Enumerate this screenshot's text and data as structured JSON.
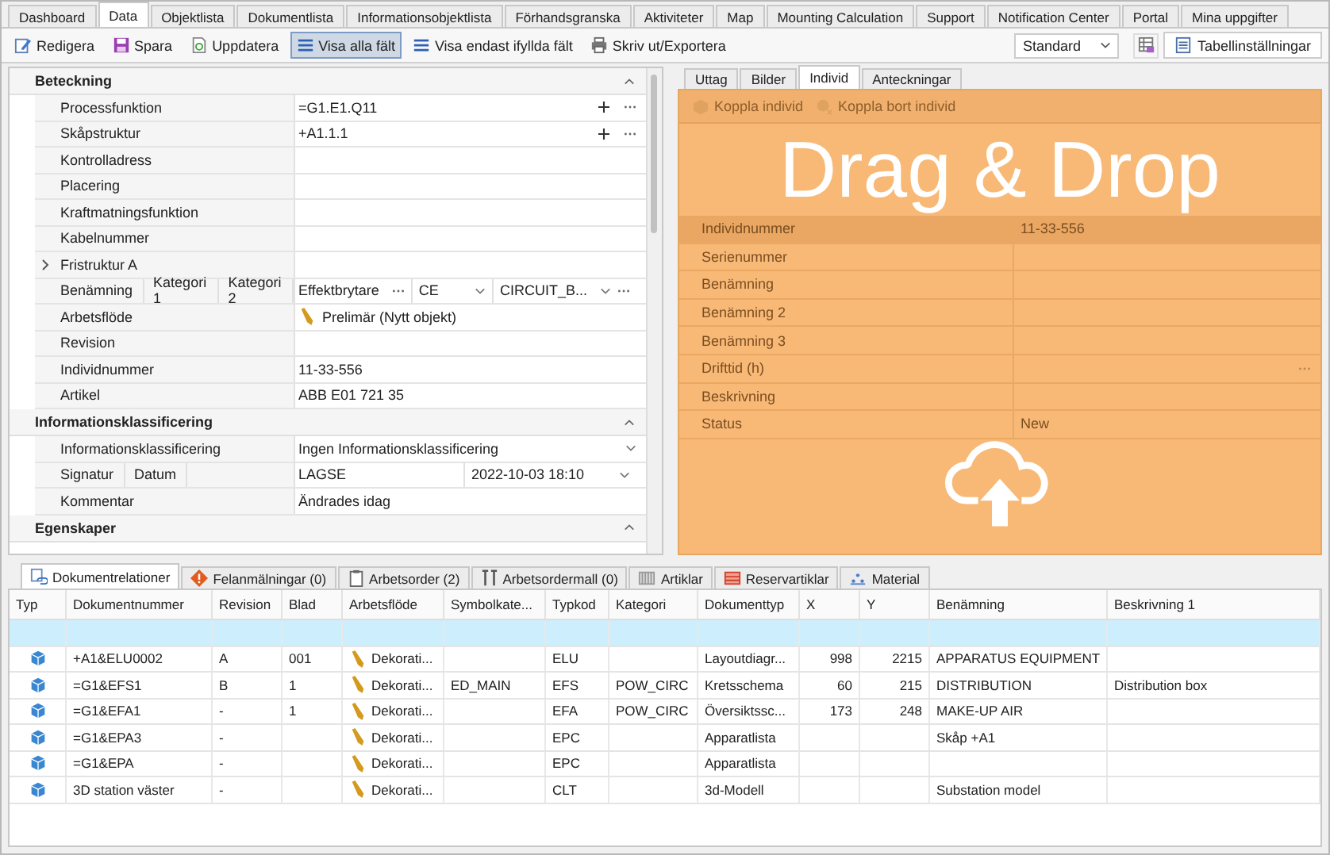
{
  "top_tabs": [
    {
      "label": "Dashboard",
      "selected": false
    },
    {
      "label": "Data",
      "selected": true
    },
    {
      "label": "Objektlista",
      "selected": false
    },
    {
      "label": "Dokumentlista",
      "selected": false
    },
    {
      "label": "Informationsobjektlista",
      "selected": false
    },
    {
      "label": "Förhandsgranska",
      "selected": false
    },
    {
      "label": "Aktiviteter",
      "selected": false
    },
    {
      "label": "Map",
      "selected": false
    },
    {
      "label": "Mounting Calculation",
      "selected": false
    },
    {
      "label": "Support",
      "selected": false
    },
    {
      "label": "Notification Center",
      "selected": false
    },
    {
      "label": "Portal",
      "selected": false
    },
    {
      "label": "Mina uppgifter",
      "selected": false
    }
  ],
  "toolbar": {
    "buttons": [
      {
        "label": "Redigera",
        "kind": "edit",
        "selected": false
      },
      {
        "label": "Spara",
        "kind": "save",
        "selected": false
      },
      {
        "label": "Uppdatera",
        "kind": "refresh",
        "selected": false
      },
      {
        "label": "Visa alla fält",
        "kind": "list",
        "selected": true
      },
      {
        "label": "Visa endast ifyllda fält",
        "kind": "list",
        "selected": false
      },
      {
        "label": "Skriv ut/Exportera",
        "kind": "print",
        "selected": false
      }
    ],
    "view_select": {
      "value": "Standard"
    },
    "table_settings_button": "Tabellinställningar"
  },
  "form": {
    "sections": [
      {
        "title": "Beteckning",
        "expanded": true,
        "rows": [
          {
            "kind": "field",
            "label": "Processfunktion",
            "value": "=G1.E1.Q11",
            "buttons": true
          },
          {
            "kind": "field",
            "label": "Skåpstruktur",
            "value": "+A1.1.1",
            "buttons": true
          },
          {
            "kind": "field",
            "label": "Kontrolladress"
          },
          {
            "kind": "field",
            "label": "Placering"
          },
          {
            "kind": "field",
            "label": "Kraftmatningsfunktion"
          },
          {
            "kind": "field",
            "label": "Kabelnummer"
          },
          {
            "kind": "group",
            "label": "Fristruktur A",
            "expanded": false
          },
          {
            "kind": "multi",
            "labels": [
              "Benämning",
              "Kategori 1",
              "Kategori 2"
            ],
            "values": [
              {
                "text": "Effektbrytare",
                "kind": "more"
              },
              {
                "text": "CE",
                "kind": "dropdown"
              },
              {
                "text": "CIRCUIT_B...",
                "kind": "dropdown-more"
              }
            ]
          },
          {
            "kind": "workflow",
            "label": "Arbetsflöde",
            "value": "Prelimär (Nytt objekt)"
          },
          {
            "kind": "field",
            "label": "Revision"
          },
          {
            "kind": "field",
            "label": "Individnummer",
            "value": "11-33-556"
          },
          {
            "kind": "field",
            "label": "Artikel",
            "value": "ABB E01 721 35"
          }
        ]
      },
      {
        "title": "Informationsklassificering",
        "expanded": true,
        "rows": [
          {
            "kind": "dropdown",
            "label": "Informationsklassificering",
            "value": "Ingen Informationsklassificering"
          },
          {
            "kind": "multi",
            "labels": [
              "Signatur",
              "Datum"
            ],
            "values": [
              {
                "text": "LAGSE",
                "kind": "plain"
              },
              {
                "text": "2022-10-03 18:10",
                "kind": "dropdown"
              }
            ]
          },
          {
            "kind": "field",
            "label": "Kommentar",
            "value": "Ändrades idag"
          }
        ]
      },
      {
        "title": "Egenskaper",
        "expanded": true
      }
    ]
  },
  "detail_panel": {
    "tabs": [
      {
        "label": "Uttag",
        "selected": false
      },
      {
        "label": "Bilder",
        "selected": false
      },
      {
        "label": "Individ",
        "selected": true
      },
      {
        "label": "Anteckningar",
        "selected": false
      }
    ],
    "actions": [
      {
        "label": "Koppla individ",
        "kind": "link",
        "disabled": true
      },
      {
        "label": "Koppla bort individ",
        "kind": "unlink",
        "disabled": true
      }
    ],
    "rows": [
      {
        "label": "Individnummer",
        "value": "11-33-556",
        "highlighted": true
      },
      {
        "label": "Serienummer",
        "highlighted": false
      },
      {
        "label": "Benämning",
        "highlighted": false
      },
      {
        "label": "Benämning 2",
        "highlighted": false
      },
      {
        "label": "Benämning 3",
        "highlighted": false
      },
      {
        "label": "Drifttid (h)",
        "more": true,
        "highlighted": false
      },
      {
        "label": "Beskrivning",
        "highlighted": false
      },
      {
        "label": "Status",
        "value": "New",
        "highlighted": false
      }
    ],
    "overlay": {
      "text": "Drag & Drop"
    }
  },
  "bottom_tabs": [
    {
      "label": "Dokumentrelationer",
      "kind": "relations",
      "selected": true
    },
    {
      "label": "Felanmälningar (0)",
      "kind": "fault",
      "selected": false
    },
    {
      "label": "Arbetsorder (2)",
      "kind": "clipboard",
      "selected": false
    },
    {
      "label": "Arbetsordermall (0)",
      "kind": "tools",
      "selected": false
    },
    {
      "label": "Artiklar",
      "kind": "grid",
      "selected": false
    },
    {
      "label": "Reservartiklar",
      "kind": "spare",
      "selected": false
    },
    {
      "label": "Material",
      "kind": "material",
      "selected": false
    }
  ],
  "table": {
    "columns": [
      {
        "label": "Typ",
        "kind": "icon"
      },
      {
        "label": "Dokumentnummer",
        "kind": "text"
      },
      {
        "label": "Revision",
        "kind": "text"
      },
      {
        "label": "Blad",
        "kind": "text"
      },
      {
        "label": "Arbetsflöde",
        "kind": "workflow"
      },
      {
        "label": "Symbolkate...",
        "kind": "text"
      },
      {
        "label": "Typkod",
        "kind": "text"
      },
      {
        "label": "Kategori",
        "kind": "text"
      },
      {
        "label": "Dokumenttyp",
        "kind": "text"
      },
      {
        "label": "X",
        "kind": "number"
      },
      {
        "label": "Y",
        "kind": "number"
      },
      {
        "label": "Benämning",
        "kind": "text"
      },
      {
        "label": "Beskrivning 1",
        "kind": "text"
      }
    ],
    "rows": [
      {
        "selected": true
      },
      {
        "selected": false,
        "kind": "object",
        "cells": [
          "",
          "+A1&ELU0002",
          "A",
          "001",
          "Dekorati...",
          "",
          "ELU",
          "",
          "Layoutdiagr...",
          "998",
          "2215",
          "APPARATUS EQUIPMENT",
          ""
        ]
      },
      {
        "selected": false,
        "kind": "object",
        "cells": [
          "",
          "=G1&EFS1",
          "B",
          "1",
          "Dekorati...",
          "ED_MAIN",
          "EFS",
          "POW_CIRC",
          "Kretsschema",
          "60",
          "215",
          "DISTRIBUTION",
          "Distribution box"
        ]
      },
      {
        "selected": false,
        "kind": "object",
        "cells": [
          "",
          "=G1&EFA1",
          "-",
          "1",
          "Dekorati...",
          "",
          "EFA",
          "POW_CIRC",
          "Översiktssc...",
          "173",
          "248",
          "MAKE-UP AIR",
          ""
        ]
      },
      {
        "selected": false,
        "kind": "object",
        "cells": [
          "",
          "=G1&EPA3",
          "-",
          "",
          "Dekorati...",
          "",
          "EPC",
          "",
          "Apparatlista",
          "",
          "",
          "Skåp +A1",
          ""
        ]
      },
      {
        "selected": false,
        "kind": "object",
        "cells": [
          "",
          "=G1&EPA",
          "-",
          "",
          "Dekorati...",
          "",
          "EPC",
          "",
          "Apparatlista",
          "",
          "",
          "",
          ""
        ]
      },
      {
        "selected": false,
        "kind": "object",
        "cells": [
          "",
          "3D station väster",
          "-",
          "",
          "Dekorati...",
          "",
          "CLT",
          "",
          "3d-Modell",
          "",
          "",
          "Substation model",
          ""
        ]
      }
    ]
  }
}
